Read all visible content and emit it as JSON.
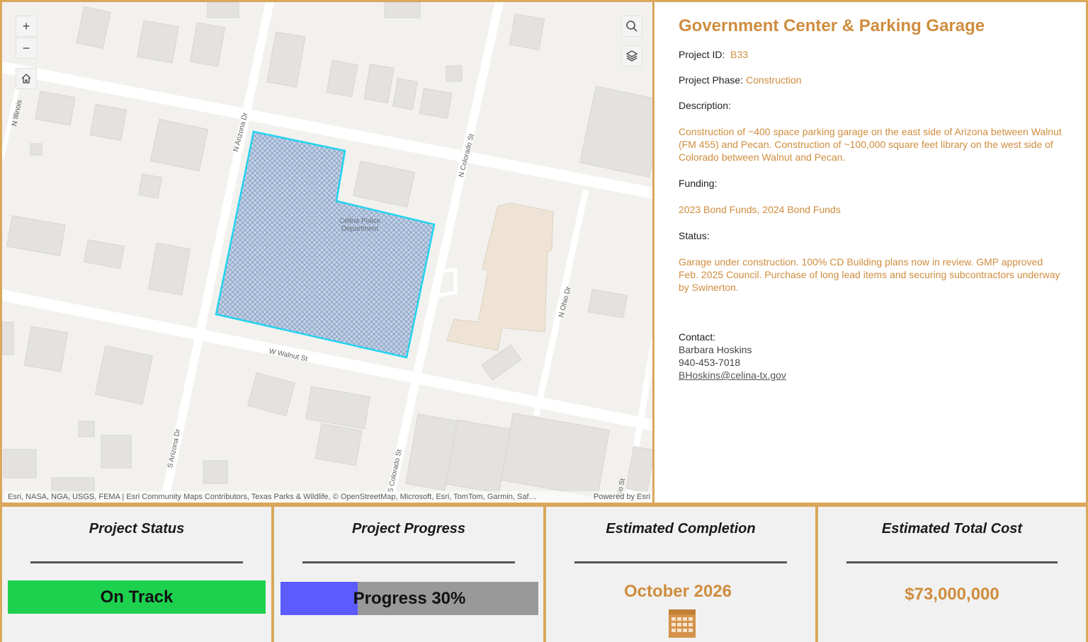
{
  "map": {
    "street_labels": {
      "n_illinois": "N Illinois",
      "n_arizona": "N Arizona Dr",
      "n_colorado": "N Colorado St",
      "w_walnut": "W Walnut St",
      "n_ohio": "N Ohio Dr",
      "s_arizona": "S Arizona Dr",
      "s_colorado": "S Colorado St",
      "ohio_st": "hio St"
    },
    "poi_label": "Celina Police Department",
    "attribution": "Esri, NASA, NGA, USGS, FEMA | Esri Community Maps Contributors, Texas Parks & Wildlife, © OpenStreetMap, Microsoft, Esri, TomTom, Garmin, Saf…",
    "powered_by": "Powered by Esri",
    "controls": {
      "zoom_in": "+",
      "zoom_out": "−"
    }
  },
  "info": {
    "title": "Government Center & Parking Garage",
    "project_id_label": "Project ID:",
    "project_id": "B33",
    "phase_label": "Project Phase:",
    "phase": "Construction",
    "description_label": "Description:",
    "description": "Construction of ~400 space parking garage on the east side of Arizona between Walnut (FM 455) and Pecan. Construction of ~100,000 square feet library on the west side of Colorado between Walnut and Pecan.",
    "funding_label": "Funding:",
    "funding": "2023 Bond Funds, 2024 Bond Funds",
    "status_label": "Status:",
    "status": "Garage under construction. 100% CD Building plans now in review. GMP approved Feb. 2025 Council. Purchase of long lead items and securing subcontractors underway by Swinerton.",
    "contact_label": "Contact:",
    "contact_name": "Barbara Hoskins",
    "contact_phone": "940-453-7018",
    "contact_email": "BHoskins@celina-tx.gov"
  },
  "cards": {
    "status": {
      "title": "Project Status",
      "value": "On Track",
      "color": "#1dd14f"
    },
    "progress": {
      "title": "Project Progress",
      "label": "Progress 30%",
      "percent": 30,
      "fill_color": "#5b5bff",
      "track_color": "#999999"
    },
    "completion": {
      "title": "Estimated Completion",
      "value": "October 2026"
    },
    "cost": {
      "title": "Estimated Total Cost",
      "value": "$73,000,000"
    }
  },
  "colors": {
    "accent": "#cf8d3e",
    "border": "#d9a85b",
    "parcel_outline": "#22d3ee"
  },
  "icons": [
    "zoom-in-icon",
    "zoom-out-icon",
    "home-icon",
    "search-icon",
    "layers-icon",
    "calendar-icon"
  ]
}
